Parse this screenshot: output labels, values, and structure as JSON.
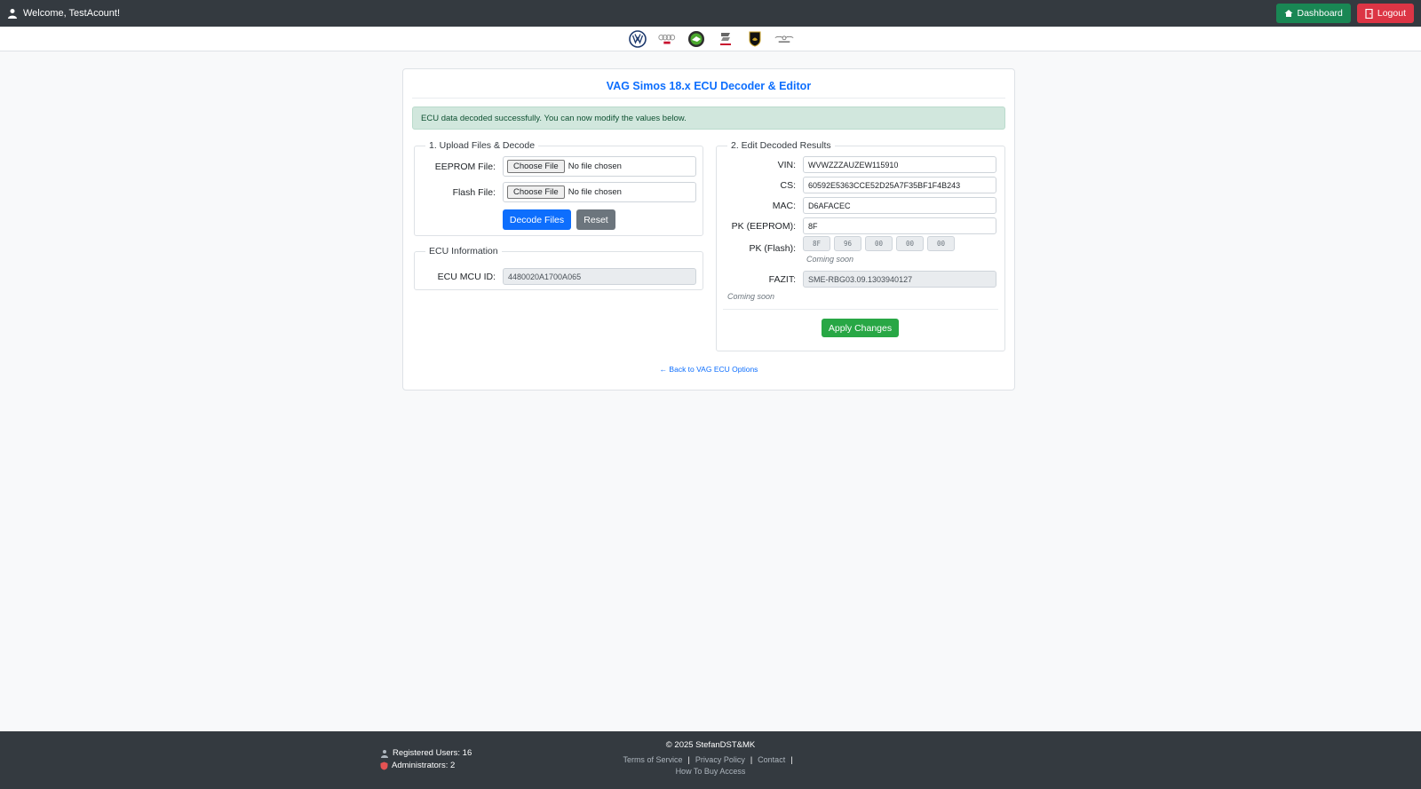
{
  "header": {
    "welcome": "Welcome, TestAcount!",
    "dashboard_label": "Dashboard",
    "logout_label": "Logout"
  },
  "brands": [
    "volkswagen-logo",
    "audi-logo",
    "skoda-logo",
    "seat-logo",
    "lamborghini-logo",
    "bentley-logo"
  ],
  "card": {
    "title": "VAG Simos 18.x ECU Decoder & Editor",
    "alert": "ECU data decoded successfully. You can now modify the values below."
  },
  "upload": {
    "legend": "1. Upload Files & Decode",
    "eeprom_label": "EEPROM File:",
    "flash_label": "Flash File:",
    "choose_label": "Choose File",
    "no_file": "No file chosen",
    "decode_label": "Decode Files",
    "reset_label": "Reset"
  },
  "ecu_info": {
    "legend": "ECU Information",
    "mcu_label": "ECU MCU ID:",
    "mcu_value": "4480020A1700A065"
  },
  "results": {
    "legend": "2. Edit Decoded Results",
    "vin_label": "VIN:",
    "vin_value": "WVWZZZAUZEW115910",
    "cs_label": "CS:",
    "cs_value": "60592E5363CCE52D25A7F35BF1F4B243",
    "mac_label": "MAC:",
    "mac_value": "D6AFACEC",
    "pk_eeprom_label": "PK (EEPROM):",
    "pk_eeprom_value": "8F",
    "pk_flash_label": "PK (Flash):",
    "pk_flash_values": [
      "8F",
      "96",
      "00",
      "00",
      "00"
    ],
    "coming_soon": "Coming soon",
    "fazit_label": "FAZIT:",
    "fazit_value": "SME-RBG03.09.1303940127",
    "apply_label": "Apply Changes"
  },
  "back_link": "← Back to VAG ECU Options",
  "footer": {
    "registered": "Registered Users: 16",
    "admins": "Administrators: 2",
    "copyright": "© 2025 StefanDST&MK",
    "links": [
      "Terms of Service",
      "Privacy Policy",
      "Contact",
      "How To Buy Access"
    ]
  },
  "colors": {
    "topbar": "#343a40",
    "primary": "#0d6efd",
    "success": "#28a745",
    "danger": "#dc3545"
  }
}
